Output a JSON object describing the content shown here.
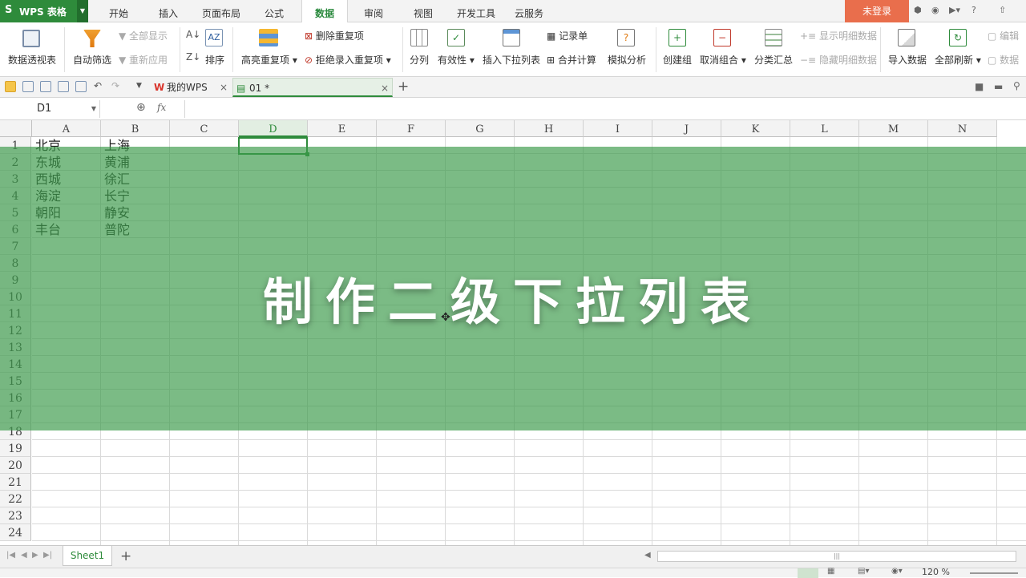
{
  "app": {
    "logo_label": "WPS 表格",
    "logo_mark": "S"
  },
  "menu": {
    "items": [
      "开始",
      "插入",
      "页面布局",
      "公式",
      "数据",
      "审阅",
      "视图",
      "开发工具",
      "云服务"
    ],
    "active": "数据",
    "login_label": "未登录",
    "help_icon": "?"
  },
  "ribbon": {
    "pivot": "数据透视表",
    "autofilter": "自动筛选",
    "show_all": "全部显示",
    "reapply": "重新应用",
    "sort": "排序",
    "highlight_dup": "高亮重复项",
    "remove_dup": "删除重复项",
    "reject_dup": "拒绝录入重复项",
    "split": "分列",
    "validity": "有效性",
    "insert_dropdown": "插入下拉列表",
    "record_form": "记录单",
    "consolidate": "合并计算",
    "whatif": "模拟分析",
    "create_group": "创建组",
    "ungroup": "取消组合",
    "subtotal": "分类汇总",
    "show_detail": "显示明细数据",
    "hide_detail": "隐藏明细数据",
    "import": "导入数据",
    "refresh_all": "全部刷新",
    "edit": "编辑",
    "data_more": "数据"
  },
  "tabs": {
    "my_wps": "我的WPS",
    "doc": "01 *"
  },
  "formula": {
    "namebox": "D1",
    "fx": "fx"
  },
  "grid": {
    "columns": [
      "A",
      "B",
      "C",
      "D",
      "E",
      "F",
      "G",
      "H",
      "I",
      "J",
      "K",
      "L",
      "M",
      "N"
    ],
    "rows": [
      "1",
      "2",
      "3",
      "4",
      "5",
      "6",
      "7",
      "8",
      "9",
      "10",
      "11",
      "12",
      "13",
      "14",
      "15",
      "16",
      "17",
      "18",
      "19",
      "20",
      "21",
      "22",
      "23",
      "24"
    ],
    "colA": [
      "北京",
      "东城",
      "西城",
      "海淀",
      "朝阳",
      "丰台"
    ],
    "colB": [
      "上海",
      "黄浦",
      "徐汇",
      "长宁",
      "静安",
      "普陀"
    ],
    "selected_column": "D"
  },
  "overlay": {
    "title": "制作二级下拉列表",
    "color": "#3c9b4b"
  },
  "sheets": {
    "active": "Sheet1",
    "add": "+"
  },
  "status": {
    "zoom": "120 %"
  },
  "colors": {
    "brand": "#2e8b3b",
    "login": "#e96e4c"
  }
}
